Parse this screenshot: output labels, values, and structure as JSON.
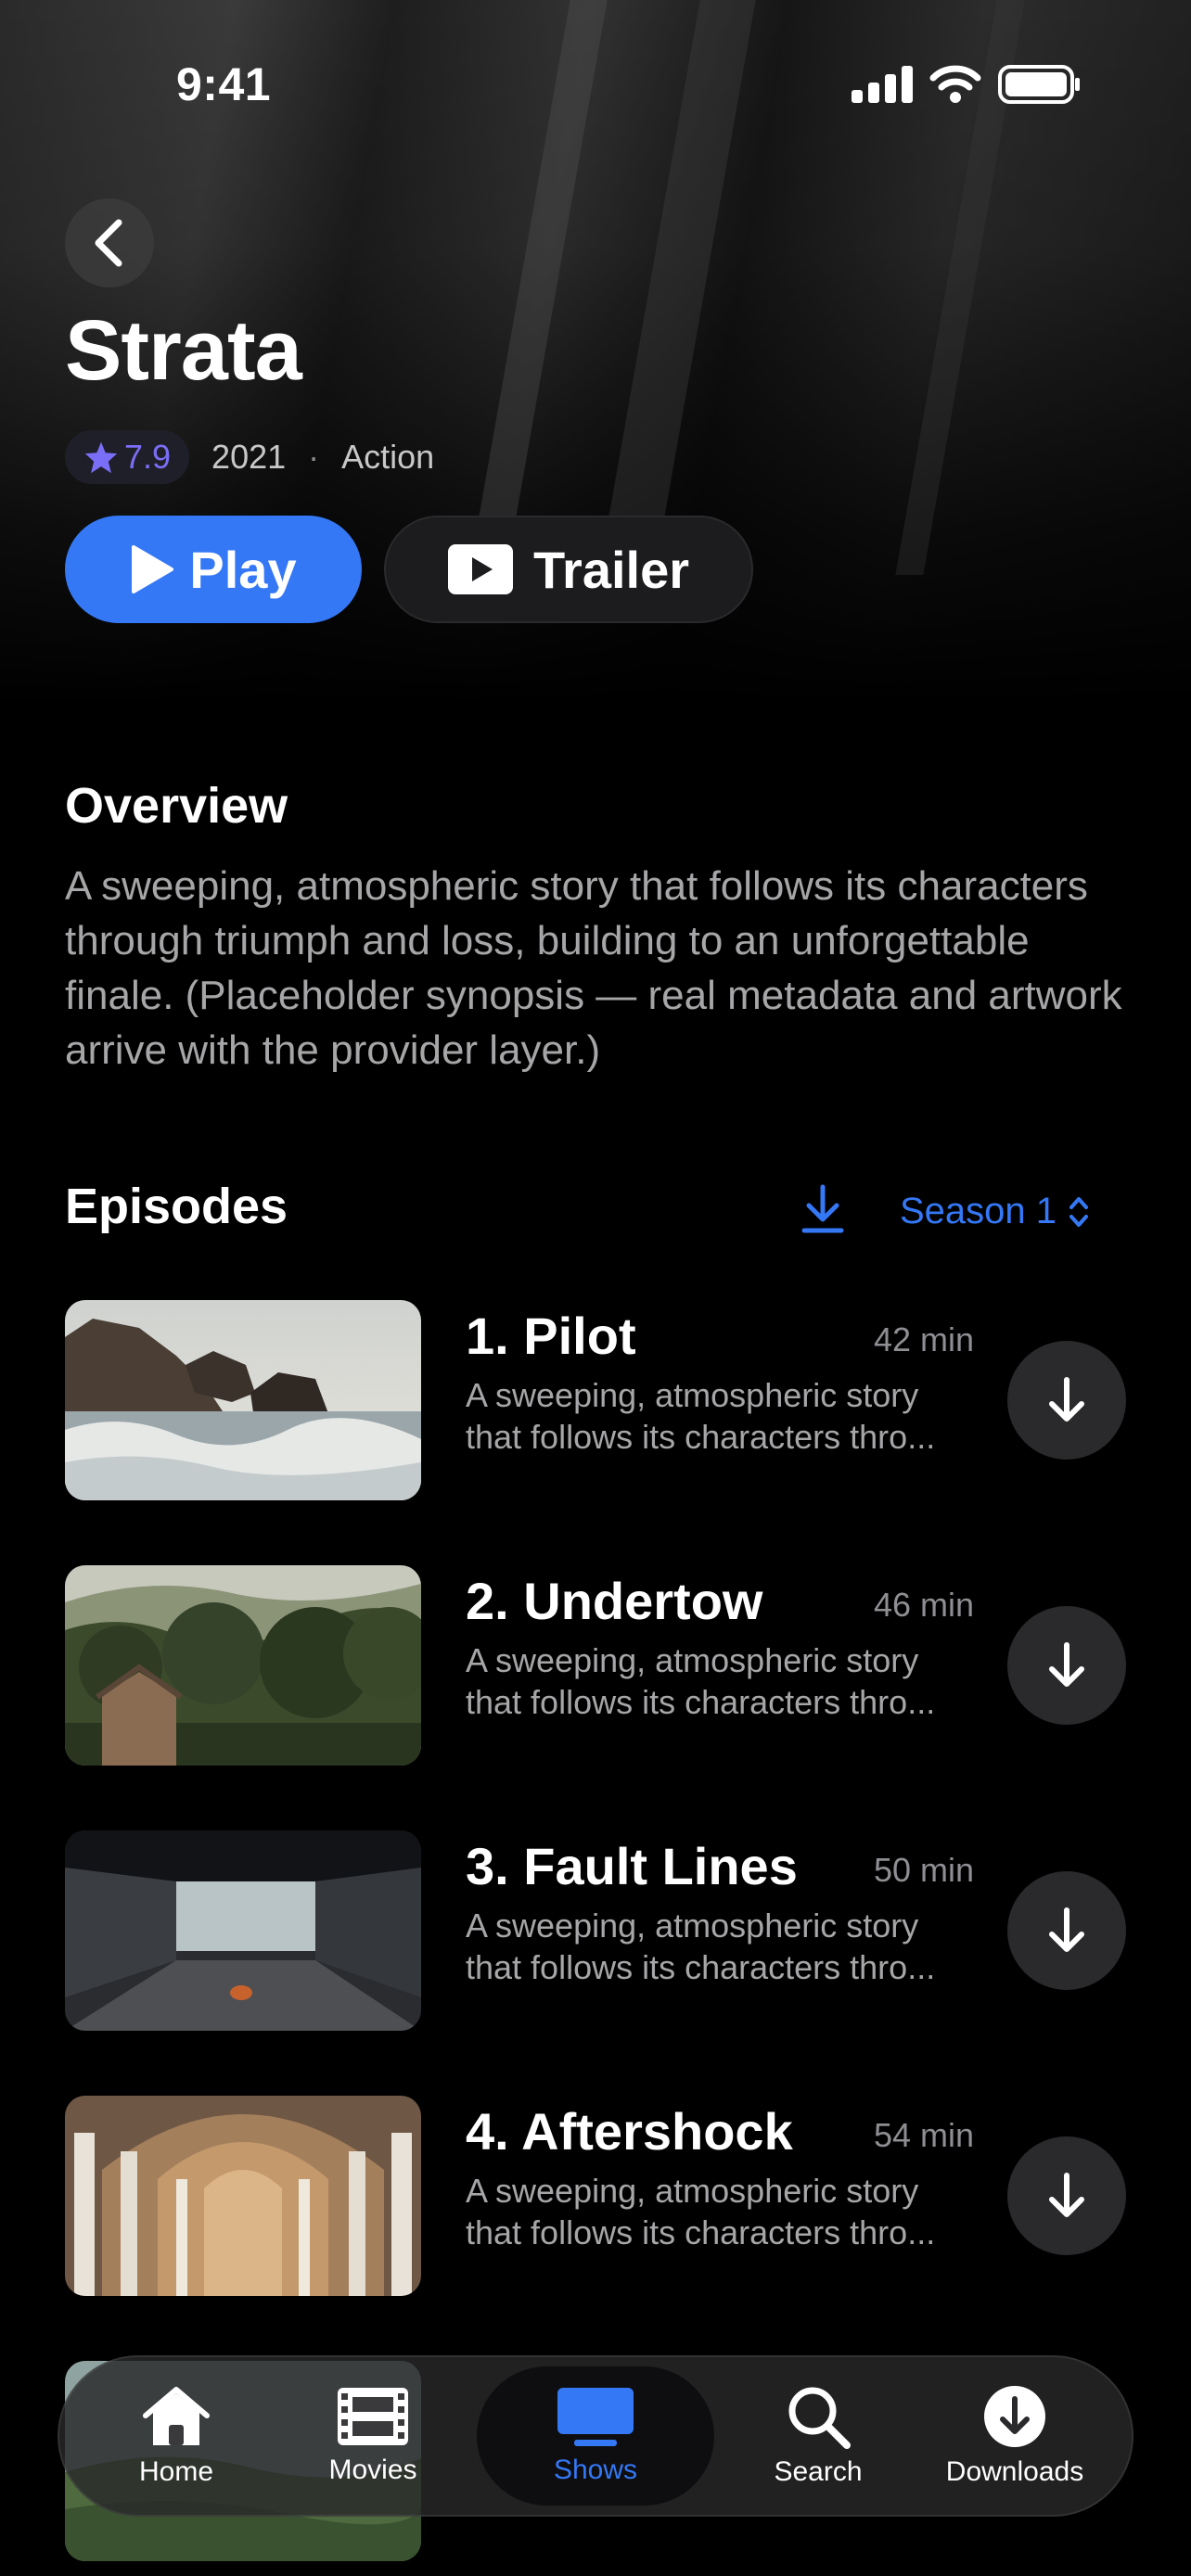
{
  "status_bar": {
    "time": "9:41"
  },
  "show": {
    "title": "Strata",
    "rating": "7.9",
    "year": "2021",
    "separator": "·",
    "genre": "Action"
  },
  "actions": {
    "play_label": "Play",
    "trailer_label": "Trailer"
  },
  "overview": {
    "heading": "Overview",
    "text": "A sweeping, atmospheric story that follows its characters through triumph and loss, building to an unforgettable finale. (Placeholder synopsis — real metadata and artwork arrive with the provider layer.)"
  },
  "episodes": {
    "heading": "Episodes",
    "season_label": "Season 1",
    "items": [
      {
        "title": "1. Pilot",
        "duration": "42 min",
        "desc_line1": "A sweeping, atmospheric story",
        "desc_line2": "that follows its characters thro..."
      },
      {
        "title": "2. Undertow",
        "duration": "46 min",
        "desc_line1": "A sweeping, atmospheric story",
        "desc_line2": "that follows its characters thro..."
      },
      {
        "title": "3. Fault Lines",
        "duration": "50 min",
        "desc_line1": "A sweeping, atmospheric story",
        "desc_line2": "that follows its characters thro..."
      },
      {
        "title": "4. Aftershock",
        "duration": "54 min",
        "desc_line1": "A sweeping, atmospheric story",
        "desc_line2": "that follows its characters thro..."
      }
    ]
  },
  "tabbar": {
    "items": [
      {
        "label": "Home",
        "icon": "home-icon"
      },
      {
        "label": "Movies",
        "icon": "film-icon"
      },
      {
        "label": "Shows",
        "icon": "tv-icon",
        "active": true
      },
      {
        "label": "Search",
        "icon": "search-icon"
      },
      {
        "label": "Downloads",
        "icon": "download-circle-icon"
      }
    ]
  },
  "colors": {
    "accent": "#3478f6",
    "rating": "#7b6ef6",
    "background": "#000000"
  }
}
